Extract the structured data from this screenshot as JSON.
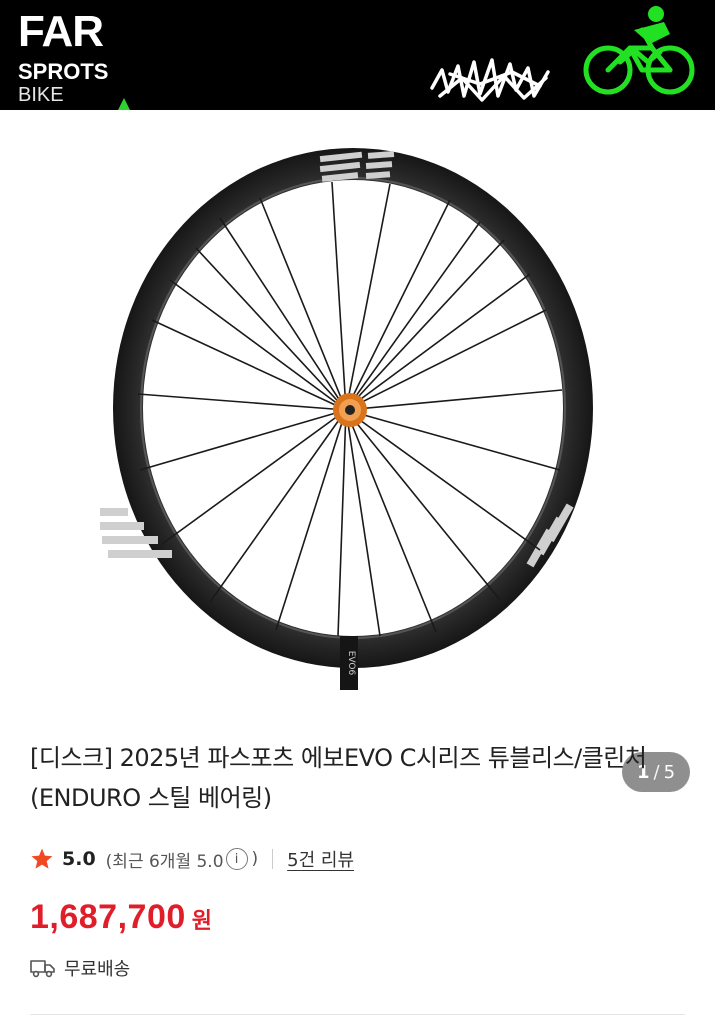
{
  "banner": {
    "logo_line1": "FAR",
    "logo_line2": "SPROTS",
    "logo_line3": "BIKE",
    "art_icons": [
      "scribble-logo",
      "cyclist-icon"
    ],
    "accent_color": "#22dd22"
  },
  "gallery": {
    "image_alt": "carbon road bike wheel",
    "rim_label": "EVO6",
    "pager_current": "1",
    "pager_separator": "/",
    "pager_total": "5"
  },
  "product": {
    "title": "[디스크] 2025년 파스포츠 에보EVO C시리즈 튜블리스/클린처(ENDURO 스틸 베어링)",
    "rating_score": "5.0",
    "recent_label": "(최근 6개월 5.0",
    "recent_close": ")",
    "info_icon_glyph": "i",
    "review_link": "5건 리뷰",
    "price": "1,687,700",
    "price_unit": "원",
    "shipping": "무료배송",
    "star_color": "#f04a23",
    "price_color": "#e01e2a"
  }
}
